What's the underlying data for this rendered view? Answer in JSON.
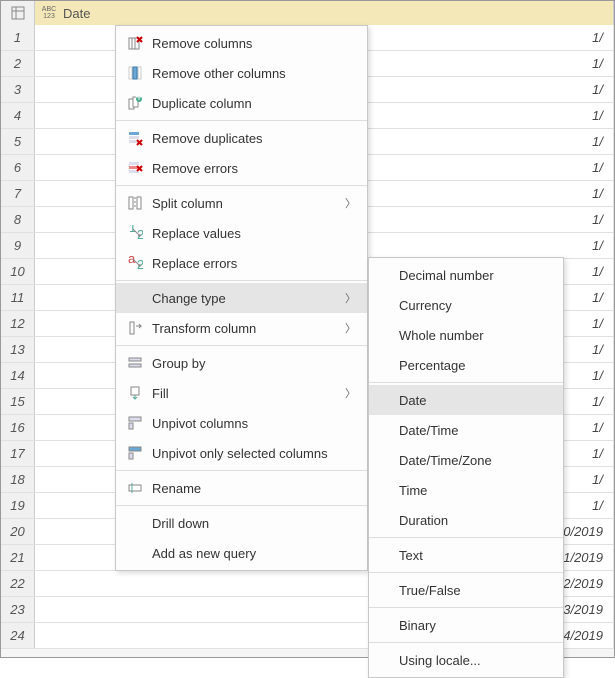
{
  "header": {
    "type_label_top": "ABC",
    "type_label_bottom": "123",
    "column_name": "Date"
  },
  "rows": [
    {
      "n": "1",
      "v": "1/"
    },
    {
      "n": "2",
      "v": "1/"
    },
    {
      "n": "3",
      "v": "1/"
    },
    {
      "n": "4",
      "v": "1/"
    },
    {
      "n": "5",
      "v": "1/"
    },
    {
      "n": "6",
      "v": "1/"
    },
    {
      "n": "7",
      "v": "1/"
    },
    {
      "n": "8",
      "v": "1/"
    },
    {
      "n": "9",
      "v": "1/"
    },
    {
      "n": "10",
      "v": "1/"
    },
    {
      "n": "11",
      "v": "1/"
    },
    {
      "n": "12",
      "v": "1/"
    },
    {
      "n": "13",
      "v": "1/"
    },
    {
      "n": "14",
      "v": "1/"
    },
    {
      "n": "15",
      "v": "1/"
    },
    {
      "n": "16",
      "v": "1/"
    },
    {
      "n": "17",
      "v": "1/"
    },
    {
      "n": "18",
      "v": "1/"
    },
    {
      "n": "19",
      "v": "1/"
    },
    {
      "n": "20",
      "v": "1/20/2019"
    },
    {
      "n": "21",
      "v": "1/21/2019"
    },
    {
      "n": "22",
      "v": "1/22/2019"
    },
    {
      "n": "23",
      "v": "1/23/2019"
    },
    {
      "n": "24",
      "v": "1/24/2019"
    }
  ],
  "menu": {
    "remove_columns": "Remove columns",
    "remove_other_columns": "Remove other columns",
    "duplicate_column": "Duplicate column",
    "remove_duplicates": "Remove duplicates",
    "remove_errors": "Remove errors",
    "split_column": "Split column",
    "replace_values": "Replace values",
    "replace_errors": "Replace errors",
    "change_type": "Change type",
    "transform_column": "Transform column",
    "group_by": "Group by",
    "fill": "Fill",
    "unpivot_columns": "Unpivot columns",
    "unpivot_only_selected": "Unpivot only selected columns",
    "rename": "Rename",
    "drill_down": "Drill down",
    "add_as_new_query": "Add as new query"
  },
  "submenu": {
    "decimal_number": "Decimal number",
    "currency": "Currency",
    "whole_number": "Whole number",
    "percentage": "Percentage",
    "date": "Date",
    "date_time": "Date/Time",
    "date_time_zone": "Date/Time/Zone",
    "time": "Time",
    "duration": "Duration",
    "text": "Text",
    "true_false": "True/False",
    "binary": "Binary",
    "using_locale": "Using locale..."
  }
}
